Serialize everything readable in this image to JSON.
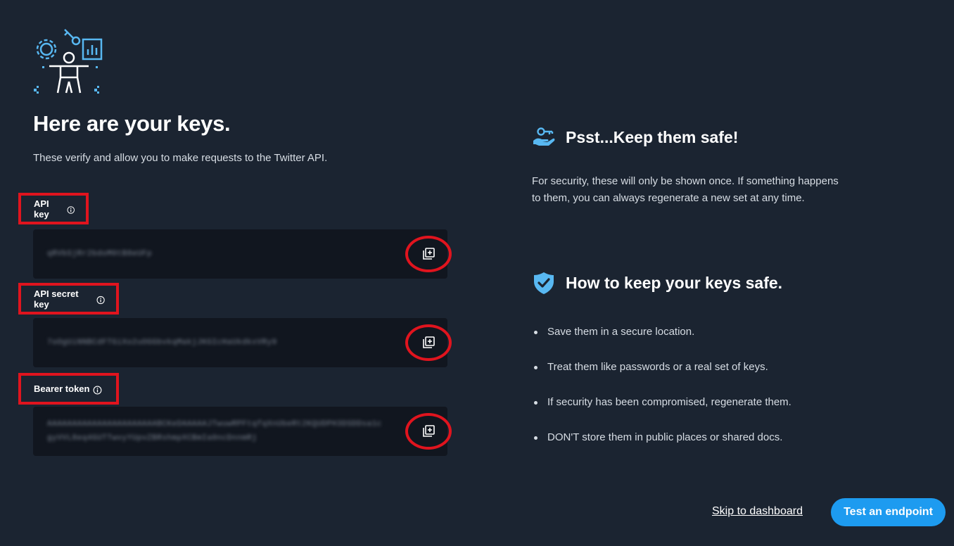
{
  "header": {
    "title": "Here are your keys.",
    "subtitle": "These verify and allow you to make requests to the Twitter API."
  },
  "keys": [
    {
      "label": "API key",
      "value": "qRVbSjRr2bdoM0tB8eUFp"
    },
    {
      "label": "API secret key",
      "value": "7oOgUiNNBCdFTGiXo2uOGGbvkqMakjJKGIcHaUkdkxVRy9"
    },
    {
      "label": "Bearer token",
      "value": "AAAAAAAAAAAAAAAAAAAAAABCKeDAAAAAJTwuwRPFtqfqXnUbeRt2KQUDPH3DSDDsa1cgyVVL8eq4GUTTwvyYUpvZBRshmpXCBmIa0ncDnnmRj"
    }
  ],
  "copy_icon": "copy-icon",
  "info_icon": "info-icon",
  "safety": {
    "heading": "Psst...Keep them safe!",
    "icon": "hand-key-icon",
    "text": "For security, these will only be shown once. If something happens to them, you can always regenerate a new set at any time."
  },
  "howto": {
    "heading": "How to keep your keys safe.",
    "icon": "shield-check-icon",
    "tips": [
      "Save them in a secure location.",
      "Treat them like passwords or a real set of keys.",
      "If security has been compromised, regenerate them.",
      "DON'T store them in public places or shared docs."
    ]
  },
  "footer": {
    "skip_label": "Skip to dashboard",
    "test_label": "Test an endpoint"
  },
  "colors": {
    "background": "#1b2431",
    "key_box": "#11161f",
    "accent": "#1d9bf0",
    "icon_blue": "#58b8f2",
    "highlight": "#e0141e"
  }
}
